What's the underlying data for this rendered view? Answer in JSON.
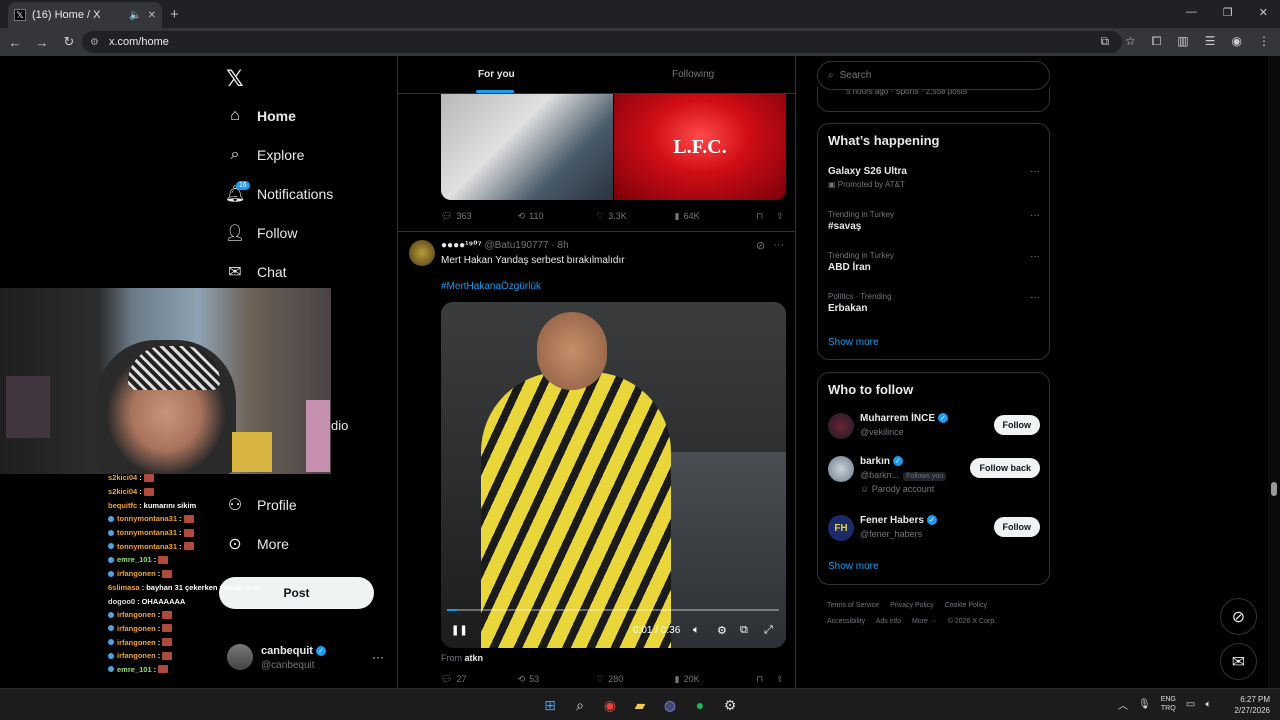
{
  "browser": {
    "tab_title": "(16) Home / X",
    "url": "x.com/home"
  },
  "nav": {
    "home": "Home",
    "explore": "Explore",
    "notifications": "Notifications",
    "notifications_badge": "16",
    "follow": "Follow",
    "chat": "Chat",
    "partial_item": "dio",
    "profile": "Profile",
    "more": "More",
    "post": "Post"
  },
  "account": {
    "name": "canbequit",
    "handle": "@canbequit"
  },
  "chat_overlay": [
    {
      "user": "s2kici04",
      "msg": ""
    },
    {
      "user": "s2kici04",
      "msg": ""
    },
    {
      "user": "bequitfc",
      "msg": "kumarını sikim"
    },
    {
      "user": "tonnymontana31",
      "msg": ""
    },
    {
      "user": "tonnymontana31",
      "msg": ""
    },
    {
      "user": "tonnymontana31",
      "msg": ""
    },
    {
      "user": "emre_101",
      "msg": ""
    },
    {
      "user": "irfangonen",
      "msg": ""
    },
    {
      "user": "6slimasa",
      "msg": "bayhan 31 çekerken yakalanmış"
    },
    {
      "user": "dogoo0",
      "msg": "OHAAAAAA"
    },
    {
      "user": "irfangonen",
      "msg": ""
    },
    {
      "user": "irfangonen",
      "msg": ""
    },
    {
      "user": "irfangonen",
      "msg": ""
    },
    {
      "user": "irfangonen",
      "msg": ""
    },
    {
      "user": "emre_101",
      "msg": ""
    }
  ],
  "feed": {
    "tabs": [
      "For you",
      "Following"
    ],
    "prev_post": {
      "image_text": "L.F.C.",
      "replies": "363",
      "reposts": "110",
      "likes": "3.3K",
      "views": "64K"
    },
    "post": {
      "name": "●●●●¹⁹⁰⁷",
      "handle": "@Batu190777",
      "time": "8h",
      "text": "Mert Hakan Yandaş serbest bırakılmalıdır",
      "hashtag": "#MertHakanaÖzgürlük",
      "video_time": "0:01 / 0:36",
      "video_progress": 0.03,
      "from_label": "From",
      "from_user": "atkn",
      "replies": "27",
      "reposts": "53",
      "likes": "280",
      "views": "20K"
    }
  },
  "right": {
    "search_placeholder": "Search",
    "peek_text": "5 hours ago · Sports · 2,558 posts",
    "happening": {
      "title": "What’s happening",
      "trends": [
        {
          "meta": "Promoted by AT&T",
          "title": "Galaxy S26 Ultra"
        },
        {
          "meta": "Trending in Turkey",
          "title": "#savaş"
        },
        {
          "meta": "Trending in Turkey",
          "title": "ABD İran"
        },
        {
          "meta": "Politics · Trending",
          "title": "Erbakan"
        }
      ],
      "show_more": "Show more"
    },
    "who_to_follow": {
      "title": "Who to follow",
      "users": [
        {
          "name": "Muharrem İNCE",
          "handle": "@vekilince",
          "button": "Follow"
        },
        {
          "name": "barkın",
          "handle": "@barkn...",
          "follows_you": "Follows you",
          "extra": "Parody account",
          "button": "Follow back"
        },
        {
          "name": "Fener Habers",
          "handle": "@fener_habers",
          "button": "Follow"
        }
      ],
      "show_more": "Show more"
    },
    "footer": [
      "Terms of Service",
      "Privacy Policy",
      "Cookie Policy",
      "Accessibility",
      "Ads info",
      "More ···",
      "© 2026 X Corp."
    ]
  },
  "taskbar": {
    "lang_top": "ENG",
    "lang_bottom": "TRQ",
    "time": "6:27 PM",
    "date": "2/27/2026"
  }
}
